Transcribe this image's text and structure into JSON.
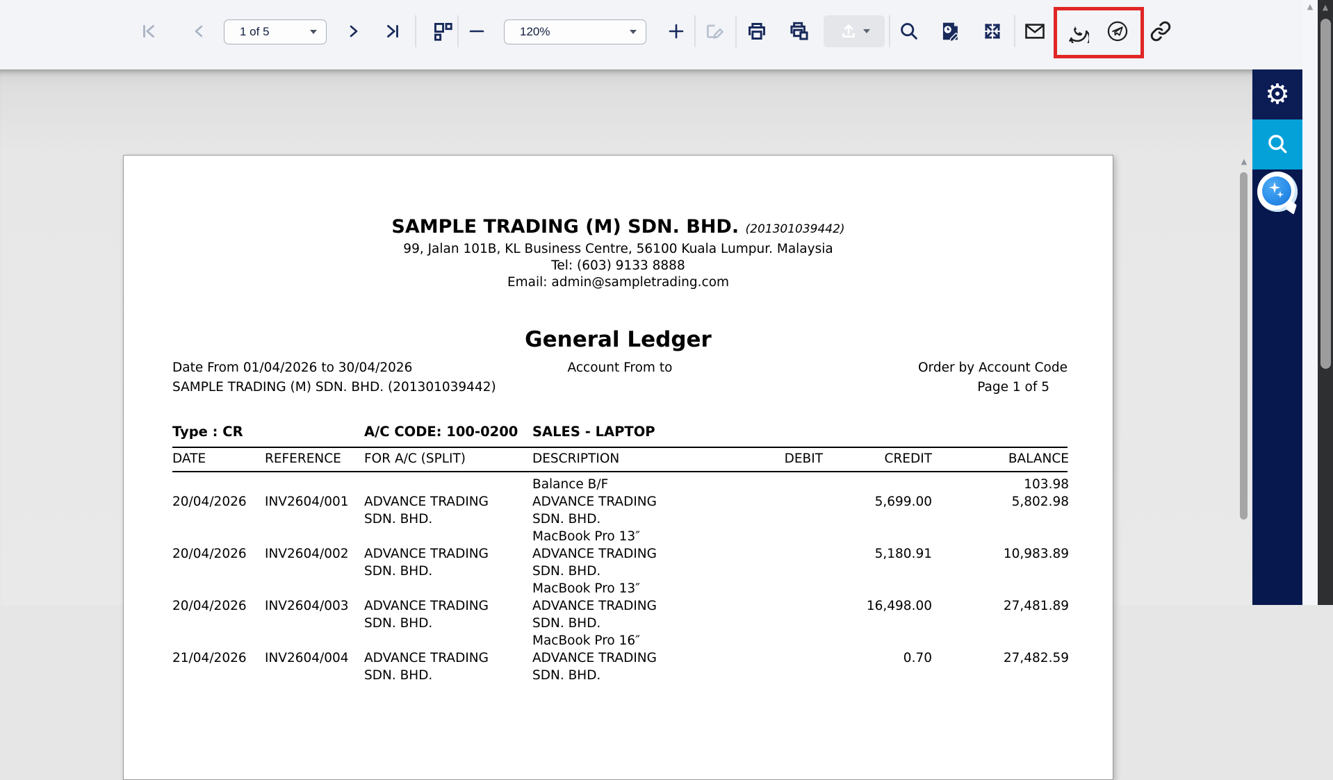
{
  "toolbar": {
    "page_select_value": "1 of 5",
    "zoom_select_value": "120%",
    "icons": [
      "first-page",
      "previous-page",
      "next-page",
      "last-page",
      "thumbnails",
      "zoom-out",
      "zoom-in",
      "edit",
      "print",
      "print-pages",
      "export-upload",
      "search",
      "design-report",
      "fullscreen",
      "email",
      "whatsapp",
      "telegram",
      "copy-link"
    ]
  },
  "annotation": {
    "highlight_color": "#e12626",
    "highlighted_icons": [
      "whatsapp",
      "telegram"
    ]
  },
  "sidebar": {
    "icons": [
      "settings-gear",
      "search",
      "ai-chat-assistant"
    ],
    "active_color": "#04a1d8"
  },
  "document": {
    "company": {
      "name": "SAMPLE TRADING (M) SDN. BHD.",
      "reg_no": "(201301039442)",
      "address": "99, Jalan 101B, KL Business Centre, 56100 Kuala Lumpur. Malaysia",
      "tel": "Tel: (603) 9133 8888",
      "email": "Email: admin@sampletrading.com"
    },
    "title": "General Ledger",
    "meta": {
      "date_range": "Date From 01/04/2026 to 30/04/2026",
      "account_from": "Account From  to",
      "order_by": "Order by Account Code",
      "company_line": "SAMPLE TRADING (M) SDN. BHD. (201301039442)",
      "page_info": "Page 1 of 5"
    },
    "account": {
      "type_label": "Type : CR",
      "code_label": "A/C CODE: 100-0200",
      "name": "SALES - LAPTOP"
    },
    "table": {
      "headers": [
        "DATE",
        "REFERENCE",
        "FOR A/C (SPLIT)",
        "DESCRIPTION",
        "DEBIT",
        "CREDIT",
        "BALANCE"
      ],
      "rows": [
        {
          "date": "",
          "reference": "",
          "for_ac": "",
          "description": "Balance B/F",
          "debit": "",
          "credit": "",
          "balance": "103.98",
          "item": ""
        },
        {
          "date": "20/04/2026",
          "reference": "INV2604/001",
          "for_ac": "ADVANCE TRADING SDN. BHD.",
          "description": "ADVANCE TRADING SDN. BHD.",
          "debit": "",
          "credit": "5,699.00",
          "balance": "5,802.98",
          "item": "MacBook Pro 13″"
        },
        {
          "date": "20/04/2026",
          "reference": "INV2604/002",
          "for_ac": "ADVANCE TRADING SDN. BHD.",
          "description": "ADVANCE TRADING SDN. BHD.",
          "debit": "",
          "credit": "5,180.91",
          "balance": "10,983.89",
          "item": "MacBook Pro 13″"
        },
        {
          "date": "20/04/2026",
          "reference": "INV2604/003",
          "for_ac": "ADVANCE TRADING SDN. BHD.",
          "description": "ADVANCE TRADING SDN. BHD.",
          "debit": "",
          "credit": "16,498.00",
          "balance": "27,481.89",
          "item": "MacBook Pro 16″"
        },
        {
          "date": "21/04/2026",
          "reference": "INV2604/004",
          "for_ac": "ADVANCE TRADING SDN. BHD.",
          "description": "ADVANCE TRADING SDN. BHD.",
          "debit": "",
          "credit": "0.70",
          "balance": "27,482.59",
          "item": ""
        }
      ]
    }
  }
}
